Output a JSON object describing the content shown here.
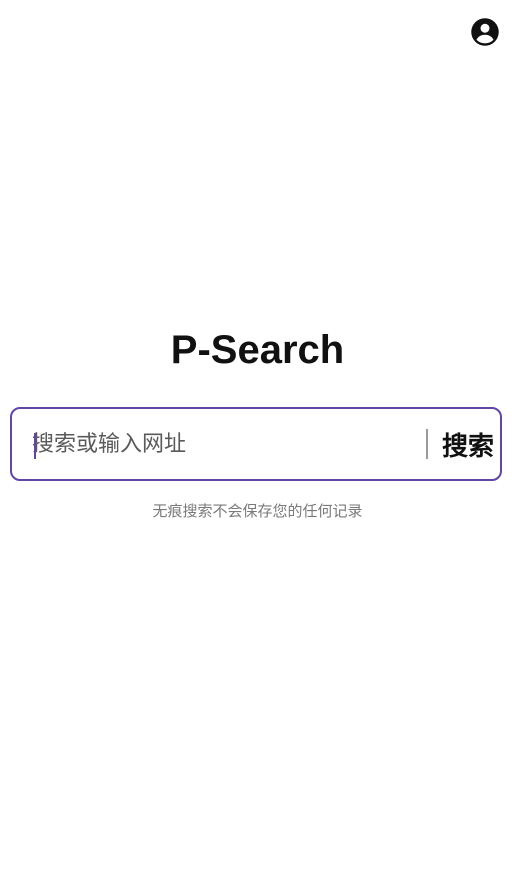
{
  "header": {
    "account_icon": "account-circle-icon"
  },
  "main": {
    "title": "P-Search",
    "search": {
      "placeholder": "搜索或输入网址",
      "value": "",
      "button_label": "搜索"
    },
    "hint": "无痕搜索不会保存您的任何记录"
  },
  "colors": {
    "accent": "#5f46a8",
    "title": "#111111",
    "hint": "#7a7a7a"
  }
}
